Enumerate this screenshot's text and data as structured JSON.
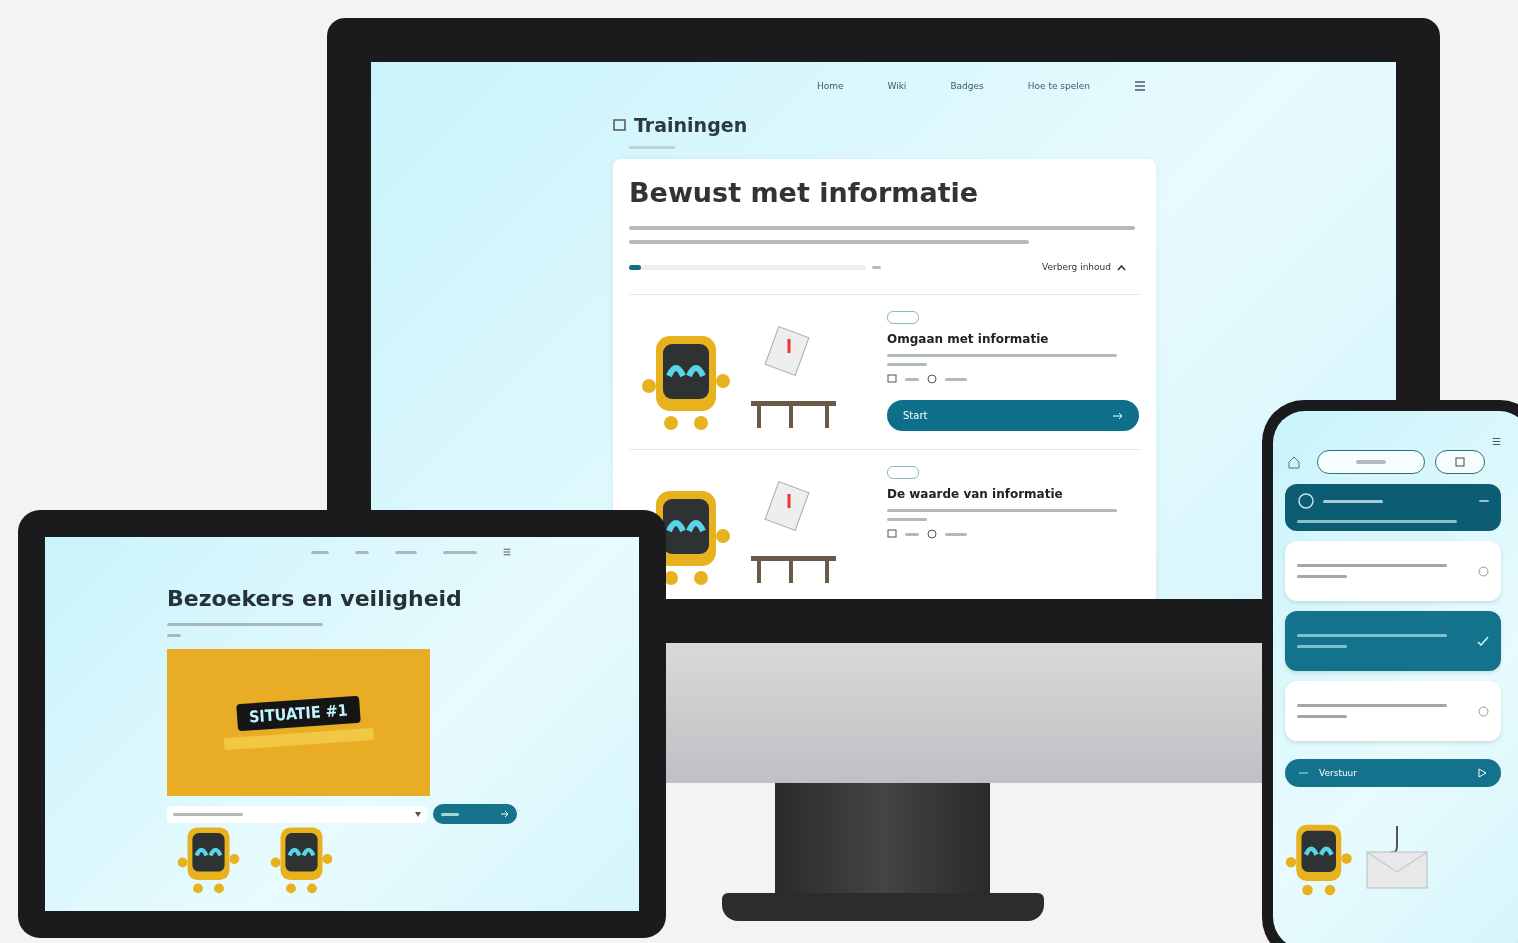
{
  "monitor": {
    "nav": [
      "Home",
      "Wiki",
      "Badges",
      "Hoe te spelen"
    ],
    "section_title": "Trainingen",
    "training": {
      "title": "Bewust met informatie",
      "progress": {
        "level": 0.05
      },
      "toggle": "Verberg inhoud",
      "modules": [
        {
          "title": "Omgaan met informatie",
          "action": "Start"
        },
        {
          "title": "De waarde van informatie"
        }
      ]
    }
  },
  "tablet": {
    "title": "Bezoekers en veiligheid",
    "video": {
      "label": "SITUATIE #1"
    }
  },
  "phone": {
    "answers": [
      {
        "selected": false
      },
      {
        "selected": true
      },
      {
        "selected": false
      }
    ],
    "submit": "Verstuur"
  }
}
